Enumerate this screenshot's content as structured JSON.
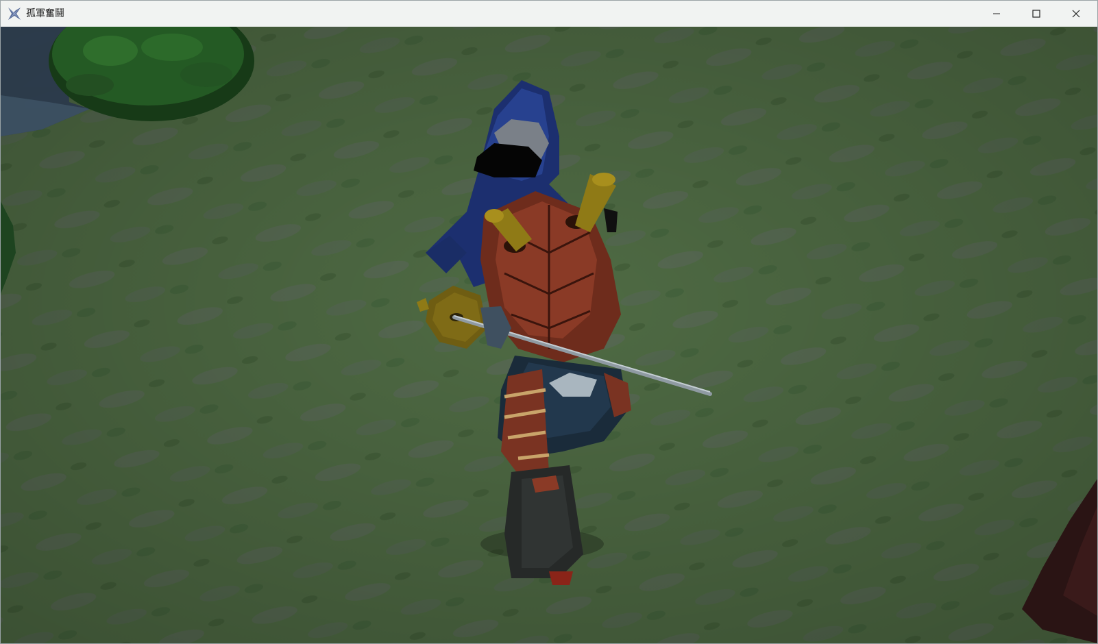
{
  "window": {
    "title": "孤軍奮鬪",
    "app_icon": "x-app-icon",
    "controls": {
      "minimize_icon": "minimize-icon",
      "maximize_icon": "maximize-icon",
      "close_icon": "close-icon"
    }
  },
  "scene": {
    "ground": "grass",
    "colors": {
      "grass": "#4f6b44",
      "grass_dark": "#3f5638",
      "bush": "#1f4a1f",
      "hood": "#1e3377",
      "armor": "#7a3322",
      "gold": "#8a7417",
      "pants": "#2a2d2c"
    }
  }
}
